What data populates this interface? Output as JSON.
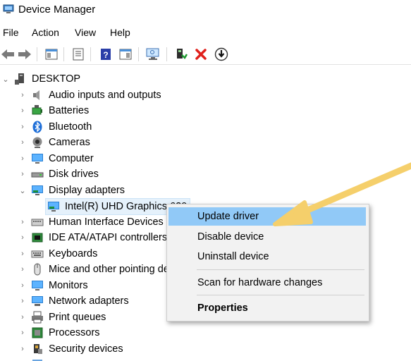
{
  "window": {
    "title": "Device Manager"
  },
  "menu": [
    "File",
    "Action",
    "View",
    "Help"
  ],
  "toolbar": [
    "back",
    "forward",
    "properties-sheet",
    "show-hide",
    "help",
    "action-view",
    "scan-monitor",
    "enable-device",
    "uninstall",
    "update-driver"
  ],
  "tree": {
    "root": "DESKTOP",
    "items": [
      {
        "label": "Audio inputs and outputs",
        "icon": "speaker-icon"
      },
      {
        "label": "Batteries",
        "icon": "battery-icon"
      },
      {
        "label": "Bluetooth",
        "icon": "bluetooth-icon"
      },
      {
        "label": "Cameras",
        "icon": "camera-icon"
      },
      {
        "label": "Computer",
        "icon": "computer-icon"
      },
      {
        "label": "Disk drives",
        "icon": "disk-icon"
      },
      {
        "label": "Display adapters",
        "icon": "display-icon",
        "expanded": true
      },
      {
        "label": "Intel(R) UHD Graphics 620",
        "icon": "display-card-icon",
        "child": true,
        "selected": true
      },
      {
        "label": "Human Interface Devices",
        "icon": "hid-icon"
      },
      {
        "label": "IDE ATA/ATAPI controllers",
        "icon": "ide-icon"
      },
      {
        "label": "Keyboards",
        "icon": "keyboard-icon"
      },
      {
        "label": "Mice and other pointing devices",
        "icon": "mouse-icon"
      },
      {
        "label": "Monitors",
        "icon": "monitor-icon"
      },
      {
        "label": "Network adapters",
        "icon": "network-icon"
      },
      {
        "label": "Print queues",
        "icon": "printer-icon"
      },
      {
        "label": "Processors",
        "icon": "cpu-icon"
      },
      {
        "label": "Security devices",
        "icon": "security-icon"
      }
    ]
  },
  "context_menu": {
    "update": "Update driver",
    "disable": "Disable device",
    "uninstall": "Uninstall device",
    "scan": "Scan for hardware changes",
    "properties": "Properties"
  },
  "colors": {
    "highlight": "#91c9f7",
    "selection": "#e5f1fb",
    "arrow": "#f5cf6b"
  }
}
